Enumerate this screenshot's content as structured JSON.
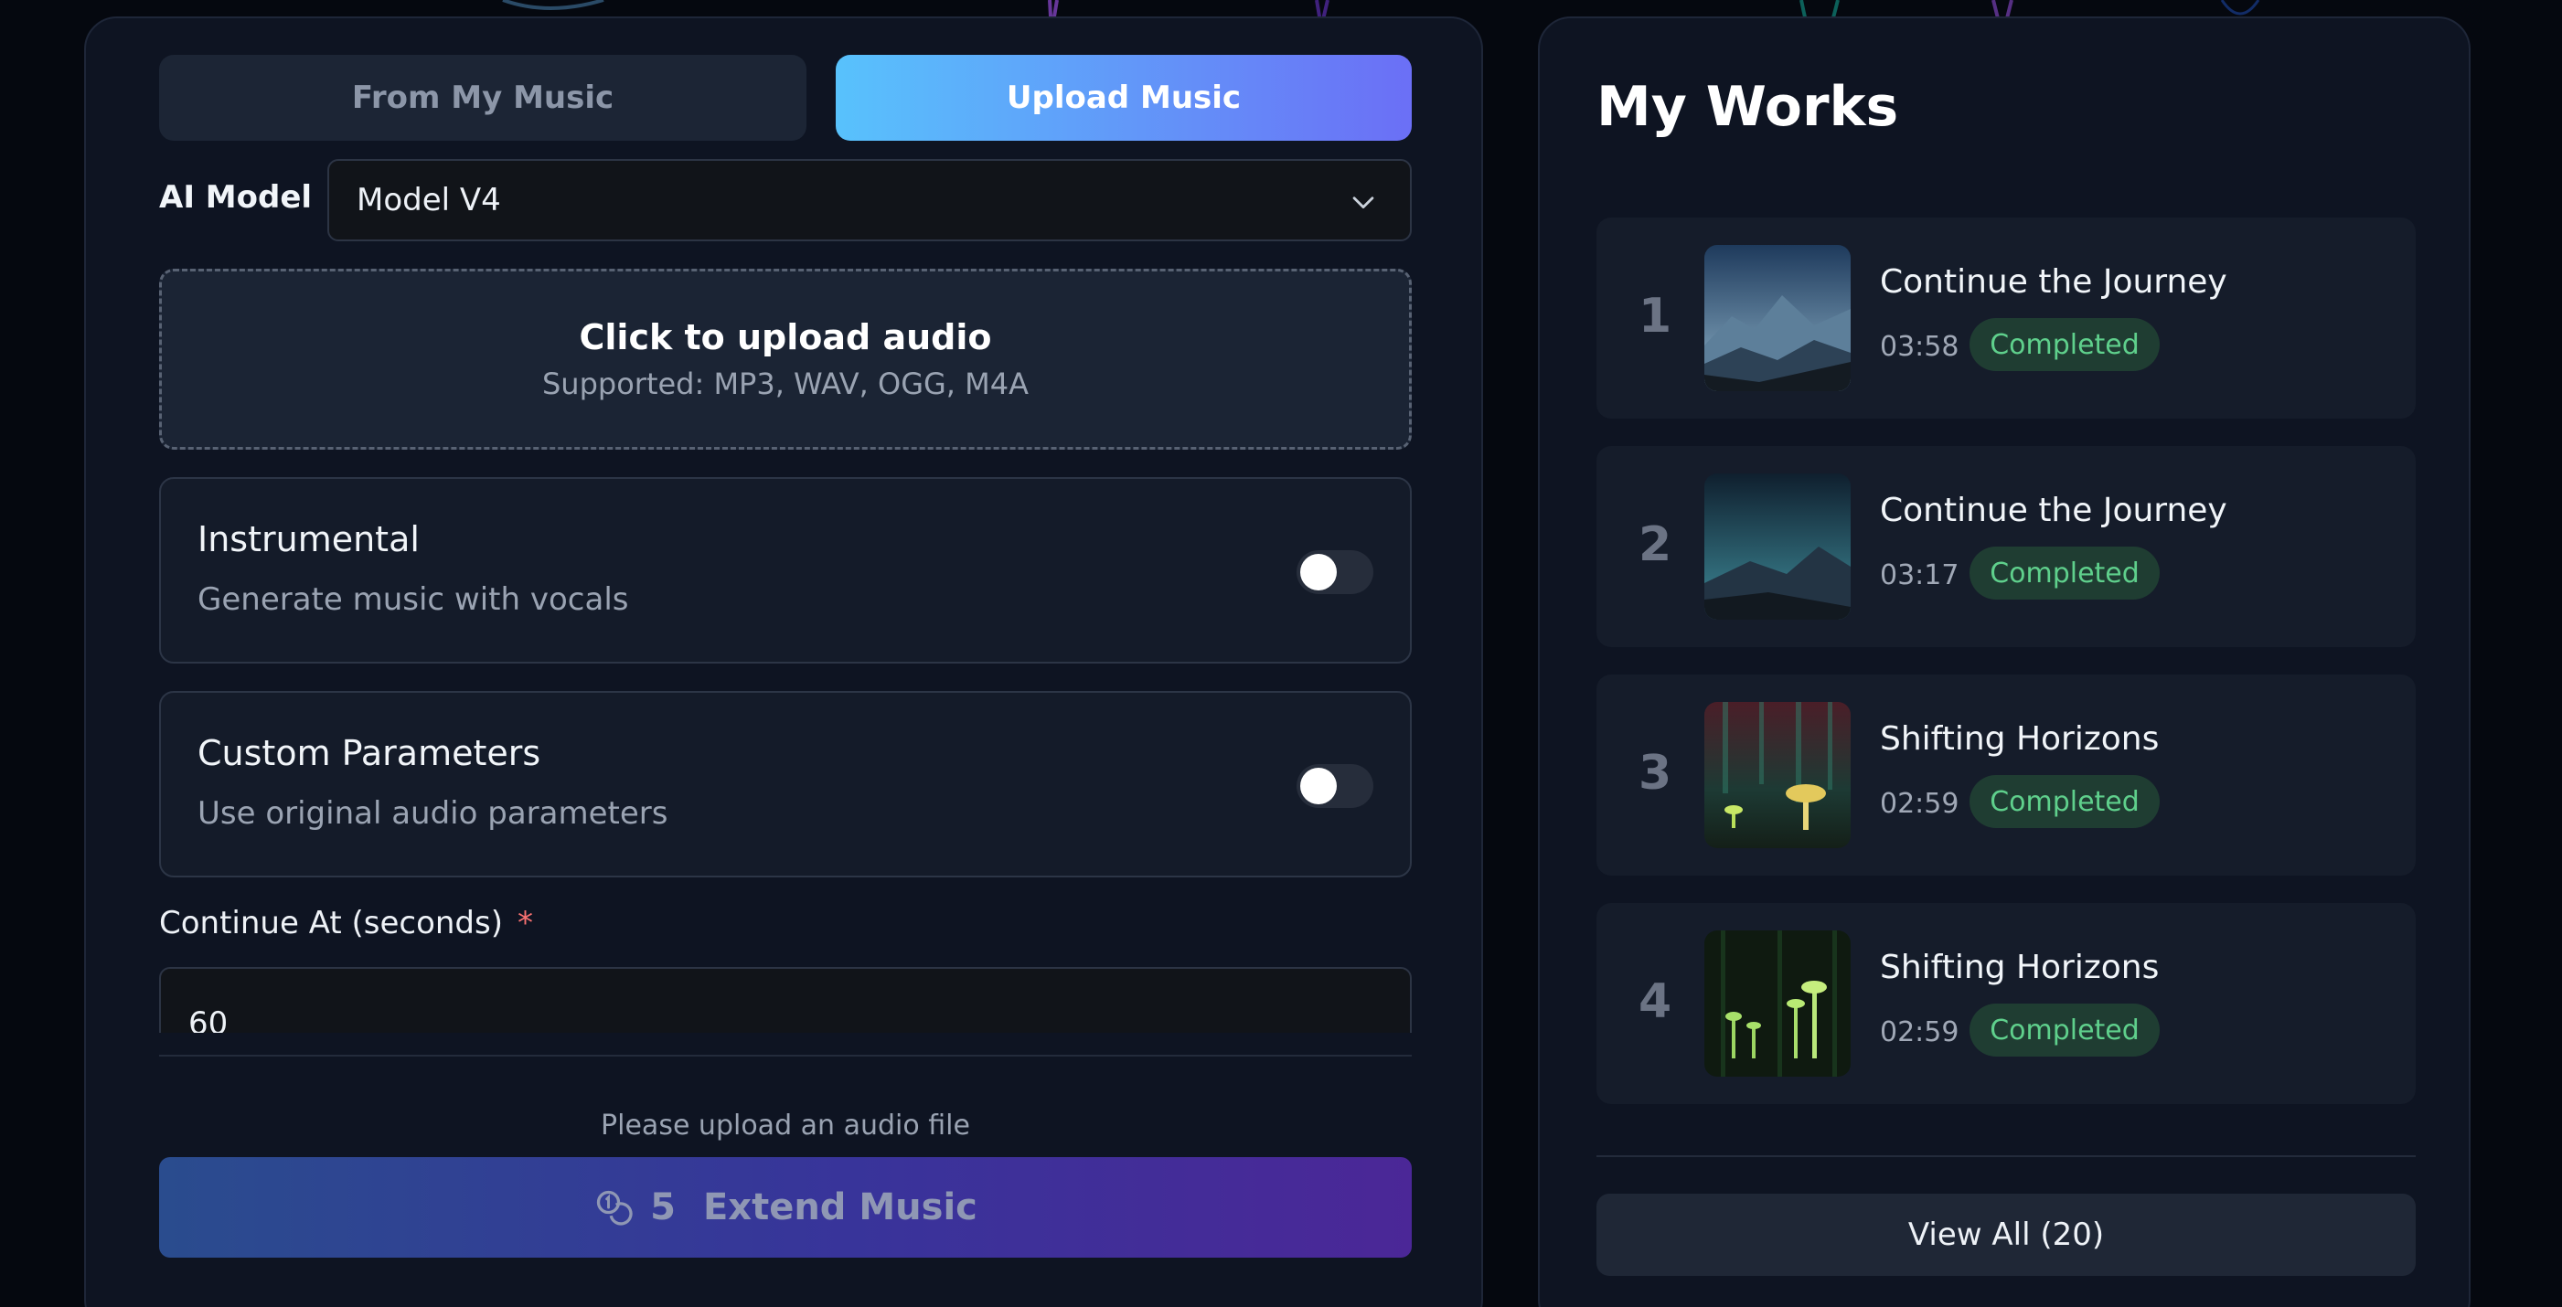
{
  "tabs": {
    "from_my_music": "From My Music",
    "upload_music": "Upload Music"
  },
  "model": {
    "label": "AI Model",
    "selected": "Model V4"
  },
  "upload": {
    "title": "Click to upload audio",
    "supported": "Supported: MP3, WAV, OGG, M4A"
  },
  "options": [
    {
      "title": "Instrumental",
      "description": "Generate music with vocals",
      "enabled": false
    },
    {
      "title": "Custom Parameters",
      "description": "Use original audio parameters",
      "enabled": false
    }
  ],
  "continue_at": {
    "label": "Continue At (seconds)",
    "required_mark": "*",
    "value": "60"
  },
  "hint": "Please upload an audio file",
  "extend": {
    "cost": "5",
    "label": "Extend Music",
    "icon": "coins-icon"
  },
  "works": {
    "title": "My Works",
    "items": [
      {
        "rank": "1",
        "title": "Continue the Journey",
        "duration": "03:58",
        "status": "Completed"
      },
      {
        "rank": "2",
        "title": "Continue the Journey",
        "duration": "03:17",
        "status": "Completed"
      },
      {
        "rank": "3",
        "title": "Shifting Horizons",
        "duration": "02:59",
        "status": "Completed"
      },
      {
        "rank": "4",
        "title": "Shifting Horizons",
        "duration": "02:59",
        "status": "Completed"
      }
    ],
    "view_all": "View All (20)"
  },
  "colors": {
    "accent_start": "#58c2fc",
    "accent_end": "#6b6ff6",
    "completed": "#5fd08c",
    "required": "#f87171"
  }
}
